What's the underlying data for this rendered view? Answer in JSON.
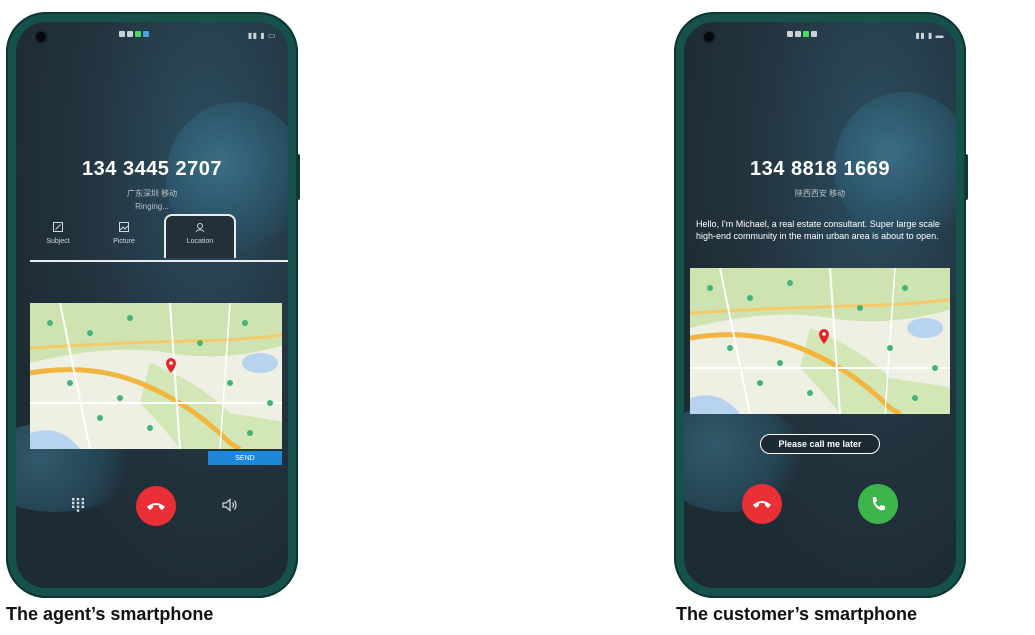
{
  "agent_phone": {
    "number": "134 3445 2707",
    "location_line": "广东深圳 移动",
    "status": "Ringing...",
    "tabs": [
      {
        "label": "Subject",
        "icon": "edit-icon"
      },
      {
        "label": "Picture",
        "icon": "image-icon"
      },
      {
        "label": "Location",
        "icon": "location-icon"
      }
    ],
    "active_tab": "Location",
    "send_label": "SEND",
    "controls": {
      "keypad_icon": "keypad-icon",
      "hangup_icon": "phone-hangup-icon",
      "speaker_icon": "speaker-icon"
    }
  },
  "customer_phone": {
    "number": "134 8818 1669",
    "location_line": "陕西西安 移动",
    "message": "Hello, I'm Michael, a real estate consultant. Super large scale high-end community in the main urban area is about to open.",
    "quick_reply_label": "Please call me later",
    "controls": {
      "hangup_icon": "phone-hangup-icon",
      "answer_icon": "phone-answer-icon"
    }
  },
  "captions": {
    "agent": "The agent’s smartphone",
    "customer": "The customer’s smartphone"
  },
  "colors": {
    "hangup": "#ea2f36",
    "answer": "#3cb54a",
    "send_button": "#1e88d8",
    "phone_frame": "#16514c"
  }
}
